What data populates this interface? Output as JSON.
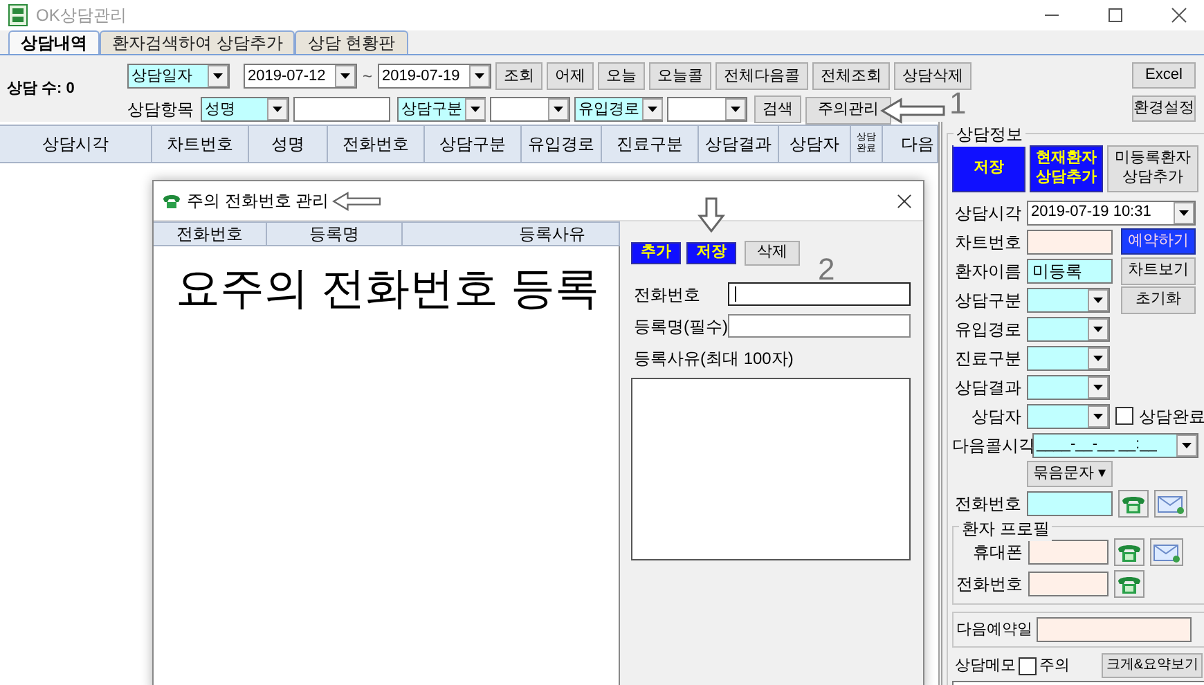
{
  "window": {
    "title": "OK상담관리"
  },
  "tabs": [
    {
      "label": "상담내역",
      "selected": true
    },
    {
      "label": "환자검색하여 상담추가",
      "selected": false
    },
    {
      "label": "상담 현황판",
      "selected": false
    }
  ],
  "toolbar": {
    "count_label": "상담 수: 0",
    "date_type": "상담일자",
    "date_from": "2019-07-12",
    "range_separator": "~",
    "date_to": "2019-07-19",
    "buttons": [
      "조회",
      "어제",
      "오늘",
      "오늘콜",
      "전체다음콜",
      "전체조회",
      "상담삭제"
    ],
    "item_label": "상담항목",
    "filters": [
      {
        "kind": "select",
        "value": "성명"
      },
      {
        "kind": "text"
      },
      {
        "kind": "select",
        "value": "상담구분"
      },
      {
        "kind": "blank"
      },
      {
        "kind": "select",
        "value": "유입경로"
      },
      {
        "kind": "blank"
      }
    ],
    "search_button": "검색",
    "caution_button": {
      "label": "주의관리",
      "callout": "1"
    },
    "side_buttons": [
      "Excel",
      "환경설정"
    ]
  },
  "table": {
    "columns": [
      "상담시각",
      "차트번호",
      "성명",
      "전화번호",
      "상담구분",
      "유입경로",
      "진료구분",
      "상담결과",
      "상담자",
      "상담완료",
      "다음"
    ]
  },
  "dialog": {
    "title": "주의 전화번호 관리",
    "title_callout": true,
    "columns": [
      "전화번호",
      "등록명",
      "등록사유"
    ],
    "overlay_text": "요주의 전화번호 등록",
    "buttons": [
      {
        "label": "추가",
        "kind": "primary",
        "callout": false
      },
      {
        "label": "저장",
        "kind": "primary",
        "callout": true
      },
      {
        "label": "삭제",
        "kind": "normal",
        "callout": false
      }
    ],
    "step_number": "2",
    "fields": [
      {
        "label": "전화번호",
        "focused": true
      },
      {
        "label": "등록명(필수)",
        "focused": false
      }
    ],
    "reason": {
      "label": "등록사유(최대 100자)"
    }
  },
  "consult_info": {
    "title": "상담정보",
    "buttons": [
      {
        "label": "저장",
        "kind": "primary"
      },
      {
        "label": "현재환자 상담추가",
        "kind": "primary"
      },
      {
        "label": "미등록환자 상담추가",
        "kind": "normal"
      }
    ],
    "time": {
      "label": "상담시각",
      "value": "2019-07-19  10:31"
    },
    "chart_number": {
      "label": "차트번호"
    },
    "reserve_button": "예약하기",
    "patient_name": {
      "label": "환자이름",
      "value": "미등록"
    },
    "chart_button": "차트보기",
    "category": {
      "label": "상담구분"
    },
    "reset_button": "초기화",
    "inflow": {
      "label": "유입경로"
    },
    "treatment": {
      "label": "진료구분"
    },
    "result": {
      "label": "상담결과"
    },
    "counselor": {
      "label": "상담자"
    },
    "completed": {
      "label": "상담완료",
      "checked": false
    },
    "next_call": {
      "label": "다음콜시각",
      "value": "____-__-__ __:__"
    },
    "bulk_sms_button": "묶음문자 ▾",
    "phone": {
      "label": "전화번호"
    },
    "profile": {
      "title": "환자 프로필",
      "mobile": {
        "label": "휴대폰"
      },
      "phone": {
        "label": "전화번호"
      }
    },
    "next_reservation": {
      "label": "다음예약일"
    },
    "memo": {
      "label": "상담메모",
      "caution": {
        "label": "주의",
        "checked": false
      },
      "expand_button": "크게&요약보기"
    }
  }
}
